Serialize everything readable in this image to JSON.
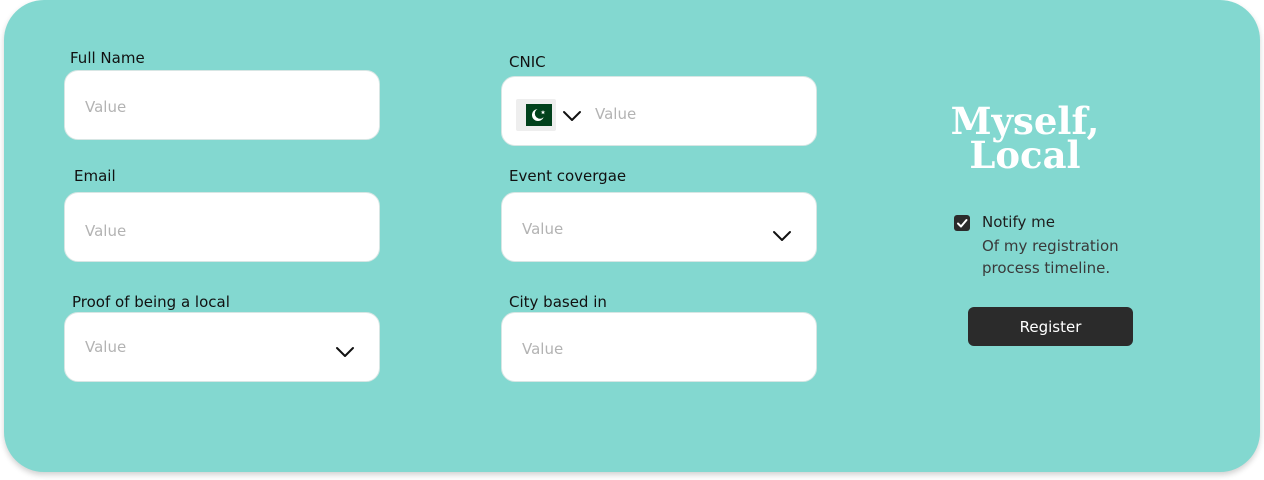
{
  "form": {
    "full_name": {
      "label": "Full Name",
      "placeholder": "Value"
    },
    "email": {
      "label": "Email",
      "placeholder": "Value"
    },
    "proof": {
      "label": "Proof of being a local",
      "placeholder": "Value"
    },
    "cnic": {
      "label": "CNIC",
      "placeholder": "Value",
      "country_icon": "pakistan-flag-icon"
    },
    "event_coverage": {
      "label": "Event covergae",
      "placeholder": "Value"
    },
    "city": {
      "label": "City based in",
      "placeholder": "Value"
    }
  },
  "brand": {
    "line1": "Myself,",
    "line2": "Local"
  },
  "notify": {
    "checked": true,
    "title": "Notify me",
    "description": "Of my registration process timeline."
  },
  "register_label": "Register",
  "colors": {
    "background": "#83d8d0",
    "button": "#2b2b2b",
    "flag_green": "#01411c"
  }
}
